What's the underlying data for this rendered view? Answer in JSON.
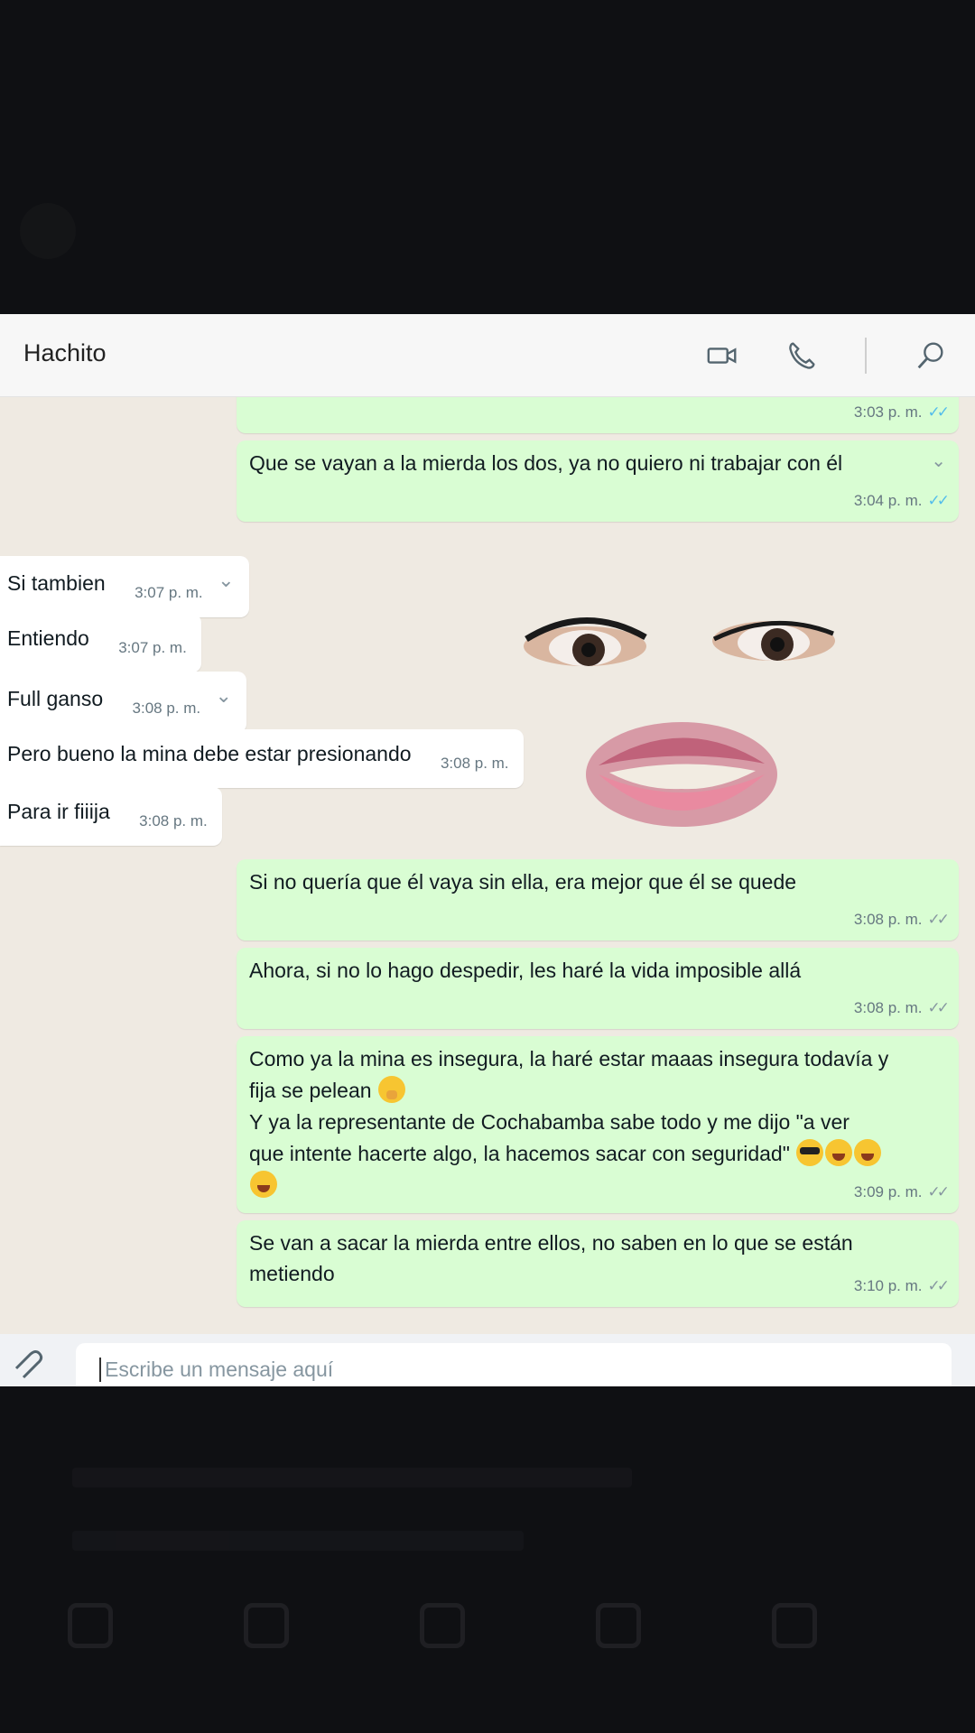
{
  "chat": {
    "contact_name": "Hachito",
    "input_placeholder": "Escribe un mensaje aquí",
    "messages": [
      {
        "dir": "out",
        "text": "Que se vayan a la mierda los dos, ya no quiero ni trabajar con él",
        "time": "3:04 p. m."
      },
      {
        "dir": "in",
        "text": "Si tambien",
        "time": "3:07 p. m."
      },
      {
        "dir": "in",
        "text": "Entiendo",
        "time": "3:07 p. m."
      },
      {
        "dir": "in",
        "text": "Full ganso",
        "time": "3:08 p. m."
      },
      {
        "dir": "in",
        "text": "Pero bueno la mina debe estar presionando",
        "time": "3:08 p. m."
      },
      {
        "dir": "in",
        "text": "Para ir fiiija",
        "time": "3:08 p. m."
      },
      {
        "dir": "out",
        "text": "Si no quería que él vaya sin ella, era mejor que él se quede",
        "time": "3:08 p. m."
      },
      {
        "dir": "out",
        "text": "Ahora, si no lo hago despedir, les haré la vida imposible allá",
        "time": "3:08 p. m."
      },
      {
        "dir": "out",
        "text_line1": "Como ya la mina es insegura, la haré estar maaas insegura todavía y",
        "text_line2": "fija se pelean",
        "text_line3": "Y ya la representante de Cochabamba sabe todo y me dijo \"a ver",
        "text_line4": "que intente hacerte algo, la hacemos sacar con seguridad\"",
        "time": "3:09 p. m."
      },
      {
        "dir": "out",
        "text_line1": "Se van a sacar la mierda entre ellos, no saben en lo que se están",
        "text_line2": "metiendo",
        "time": "3:10 p. m."
      }
    ],
    "first_visible_time": "3:03 p. m."
  },
  "icons": {
    "video": "video-camera-icon",
    "call": "phone-icon",
    "search": "search-icon",
    "attach": "paperclip-icon",
    "dropdown": "chevron-down-icon"
  },
  "colors": {
    "outgoing_bubble": "#d9fdd3",
    "incoming_bubble": "#ffffff",
    "chat_background": "#efeae2",
    "read_ticks": "#53bdeb"
  }
}
